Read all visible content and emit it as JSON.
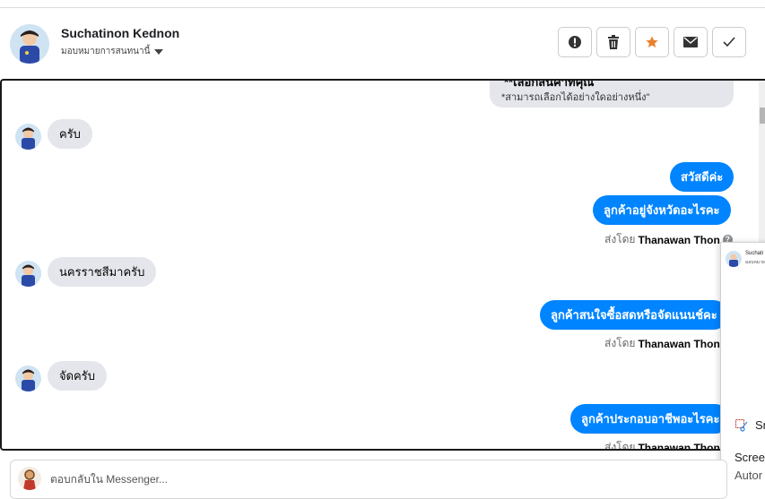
{
  "header": {
    "name": "Suchatinon Kednon",
    "assign_label": "มอบหมายการสนทนานี้",
    "actions": [
      {
        "icon": "alert-icon"
      },
      {
        "icon": "trash-icon"
      },
      {
        "icon": "star-icon",
        "color": "#e8822e"
      },
      {
        "icon": "envelope-icon"
      },
      {
        "icon": "check-icon"
      }
    ]
  },
  "colors": {
    "outgoing_bubble": "#0084ff",
    "incoming_bubble": "#e4e6eb",
    "star": "#e8822e"
  },
  "conversation": {
    "top_card_heading": "**เลือกสินค้าที่คุณ",
    "top_card_note": "*สามารถเลือกได้อย่างใดอย่างหนึ่ง\"",
    "messages": [
      {
        "dir": "in",
        "text": "ครับ"
      },
      {
        "dir": "out",
        "text": "สวัสดีค่ะ"
      },
      {
        "dir": "out",
        "text": "ลูกค้าอยู่จังหวัดอะไรคะ"
      },
      {
        "dir": "meta",
        "prefix": "ส่งโดย",
        "sender": "Thanawan Thon"
      },
      {
        "dir": "in",
        "text": "นครราชสีมาครับ"
      },
      {
        "dir": "out",
        "text": "ลูกค้าสนใจซื้อสดหรือจัดแนนช์คะ"
      },
      {
        "dir": "meta",
        "prefix": "ส่งโดย",
        "sender": "Thanawan Thon"
      },
      {
        "dir": "in",
        "text": "จัดครับ"
      },
      {
        "dir": "out",
        "text": "ลูกค้าประกอบอาชีพอะไรคะ"
      },
      {
        "dir": "meta",
        "prefix": "ส่งโดย",
        "sender": "Thanawan Thon"
      }
    ]
  },
  "popup": {
    "name": "Suchati",
    "sub": "มอบหมาย",
    "tool_label": "Sn",
    "screen_label": "Scree",
    "auto_label": "Autor"
  },
  "reply": {
    "placeholder": "ตอบกลับใน Messenger..."
  }
}
